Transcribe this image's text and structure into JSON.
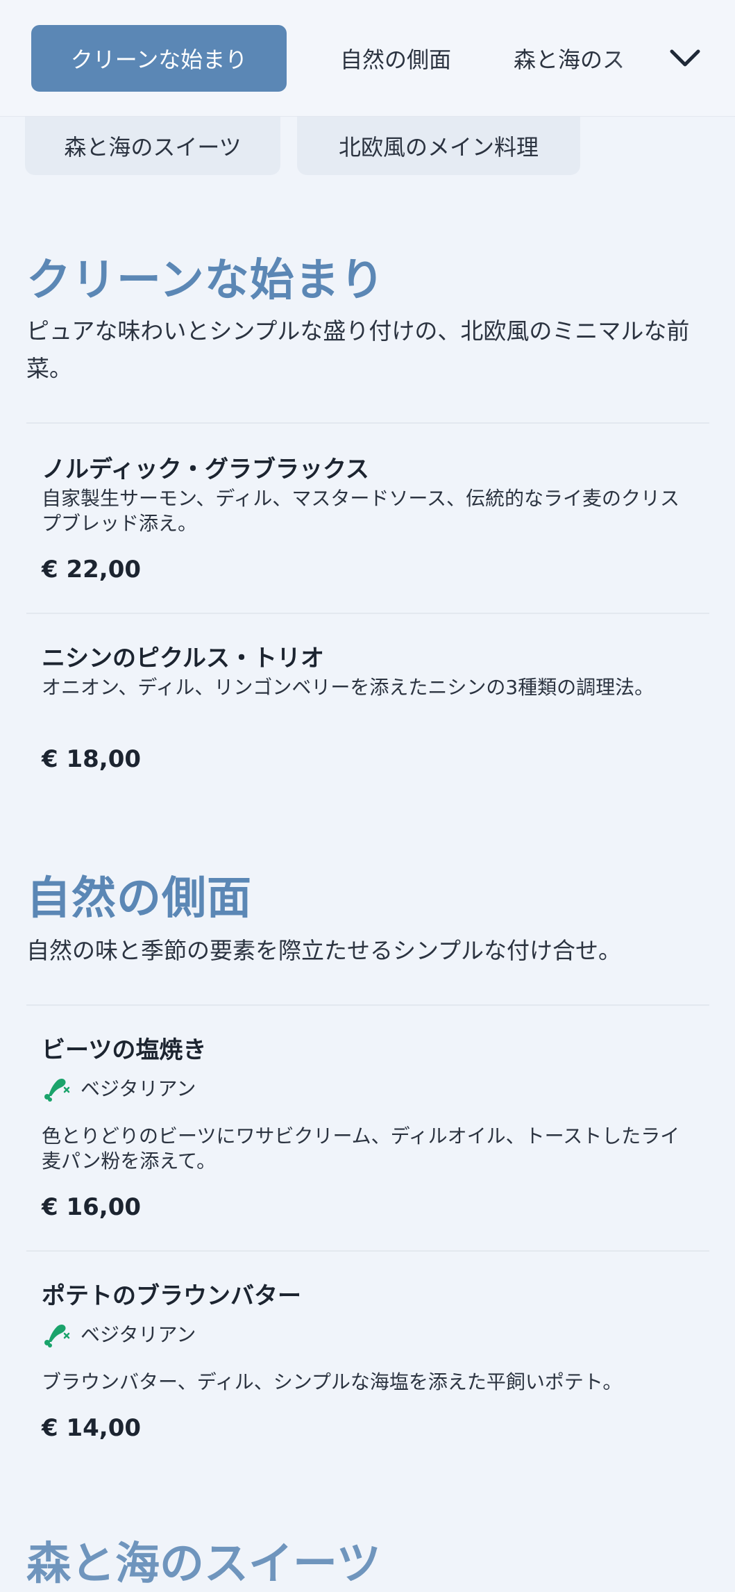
{
  "nav": {
    "tabs": [
      {
        "label": "クリーンな始まり",
        "active": true
      },
      {
        "label": "自然の側面",
        "active": false
      },
      {
        "label": "森と海のス",
        "active": false
      }
    ],
    "expand_icon": "chevron-down-icon",
    "pills": [
      {
        "label": "森と海のスイーツ"
      },
      {
        "label": "北欧風のメイン料理"
      }
    ]
  },
  "sections": [
    {
      "title": "クリーンな始まり",
      "description": "ピュアな味わいとシンプルな盛り付けの、北欧風のミニマルな前菜。",
      "items": [
        {
          "name": "ノルディック・グラブラックス",
          "description": "自家製生サーモン、ディル、マスタードソース、伝統的なライ麦のクリスプブレッド添え。",
          "price": "€ 22,00"
        },
        {
          "name": "ニシンのピクルス・トリオ",
          "description": "オニオン、ディル、リンゴンベリーを添えたニシンの3種類の調理法。",
          "price": "€ 18,00"
        }
      ]
    },
    {
      "title": "自然の側面",
      "description": "自然の味と季節の要素を際立たせるシンプルな付け合せ。",
      "items": [
        {
          "name": "ビーツの塩焼き",
          "badge": "ベジタリアン",
          "badge_icon": "no-meat-icon",
          "description": "色とりどりのビーツにワサビクリーム、ディルオイル、トーストしたライ麦パン粉を添えて。",
          "price": "€ 16,00"
        },
        {
          "name": "ポテトのブラウンバター",
          "badge": "ベジタリアン",
          "badge_icon": "no-meat-icon",
          "description": "ブラウンバター、ディル、シンプルな海塩を添えた平飼いポテト。",
          "price": "€ 14,00"
        }
      ]
    },
    {
      "title": "森と海のスイーツ"
    }
  ],
  "colors": {
    "accent": "#5b87b5",
    "background": "#f0f4fa",
    "badge_green": "#1aa36b"
  }
}
